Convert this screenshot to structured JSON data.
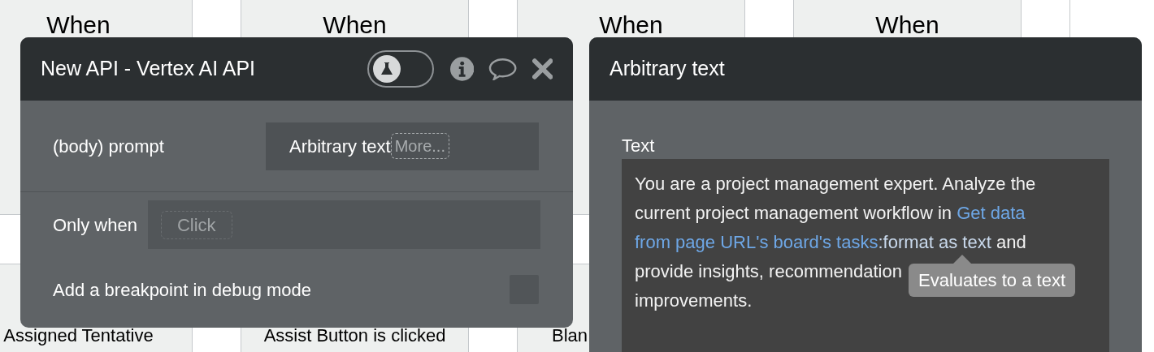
{
  "background": {
    "columns": [
      {
        "top": "When",
        "bottom": "Assigned Tentative",
        "kind": "centered"
      },
      {
        "top": "When",
        "bottom": "Assist Button is clicked",
        "kind": "centered"
      },
      {
        "top": "When",
        "bottom": "Blan",
        "kind": "left"
      },
      {
        "top": "When"
      }
    ]
  },
  "action_panel": {
    "title": "New API - Vertex AI API",
    "debug_toggle": {
      "on": false
    },
    "fields": [
      {
        "label": "(body) prompt",
        "value": "Arbitrary text",
        "more": "More..."
      }
    ],
    "condition": {
      "label": "Only when",
      "placeholder": "Click"
    },
    "breakpoint": {
      "label": "Add a breakpoint in debug mode",
      "checked": false
    }
  },
  "text_panel": {
    "title": "Arbitrary text",
    "field_label": "Text",
    "lines": [
      [
        {
          "kind": "plain",
          "text": "You are a project management expert. Analyze the"
        }
      ],
      [
        {
          "kind": "plain",
          "text": "current project management workflow in "
        },
        {
          "kind": "dynamic",
          "text": "Get data"
        }
      ],
      [
        {
          "kind": "dynamic",
          "text": "from page URL's board's tasks"
        },
        {
          "kind": "operator",
          "text": ":format as text"
        },
        {
          "kind": "plain",
          "text": " and"
        }
      ],
      [
        {
          "kind": "plain",
          "text": "provide insights, recommendation"
        }
      ],
      [
        {
          "kind": "plain",
          "text": "improvements."
        }
      ]
    ],
    "tooltip": "Evaluates to a text"
  }
}
